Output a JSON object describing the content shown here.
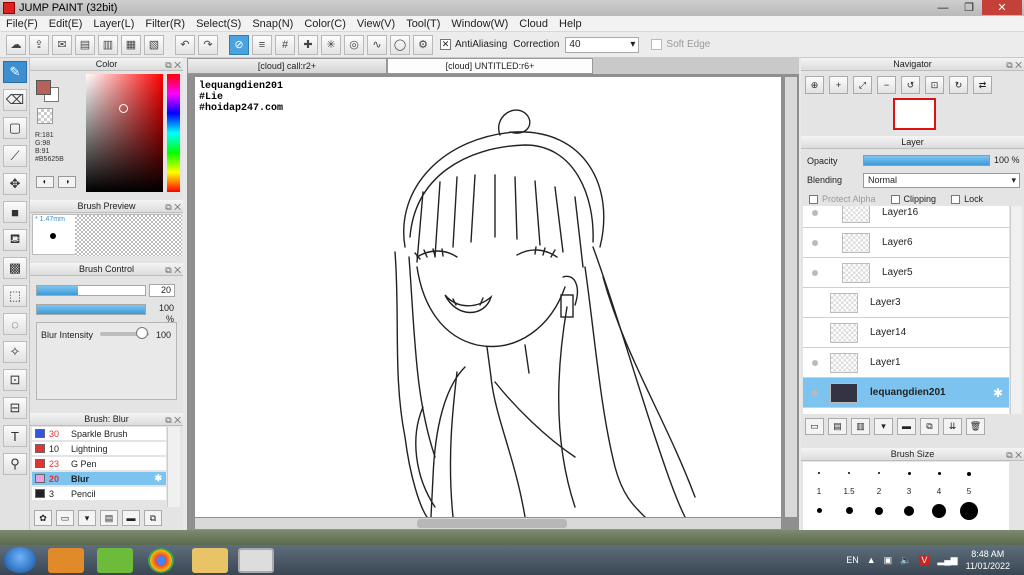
{
  "window": {
    "title": "JUMP PAINT (32bit)",
    "minimize": "—",
    "restore": "❐",
    "close": "✕"
  },
  "menu": [
    "File(F)",
    "Edit(E)",
    "Layer(L)",
    "Filter(R)",
    "Select(S)",
    "Snap(N)",
    "Color(C)",
    "View(V)",
    "Tool(T)",
    "Window(W)",
    "Cloud",
    "Help"
  ],
  "toolbar": {
    "antialiasing_label": "AntiAliasing",
    "correction_label": "Correction",
    "correction_value": "40",
    "soft_edge_label": "Soft Edge"
  },
  "color_panel": {
    "title": "Color",
    "r": "R:181",
    "g": "G:98",
    "b": "B:91",
    "hex": "#B5625B",
    "main_color": "#b5625b"
  },
  "brush_preview": {
    "title": "Brush Preview",
    "size": "* 1.47mm"
  },
  "brush_control": {
    "title": "Brush Control",
    "size_value": "20",
    "size_fraction": 0.38,
    "opacity_value": "100 %",
    "opacity_fraction": 1.0,
    "blur_label": "Blur Intensity",
    "blur_value": "100",
    "blur_fraction": 1.0
  },
  "brush_list": {
    "title": "Brush: Blur",
    "items": [
      {
        "size": "30",
        "name": "Sparkle Brush",
        "color": "#3355dd"
      },
      {
        "size": "10",
        "name": "Lightning",
        "color": "#e03333"
      },
      {
        "size": "23",
        "name": "G Pen",
        "color": "#e03333"
      },
      {
        "size": "20",
        "name": "Blur",
        "color": "#e7a0e0"
      },
      {
        "size": "3",
        "name": "Pencil",
        "color": "#222222"
      }
    ]
  },
  "canvas": {
    "tabs": [
      "[cloud] call:r2+",
      "[cloud] UNTITLED:r6+"
    ],
    "watermark": [
      "lequangdien201",
      "#Lie",
      "#hoidap247.com"
    ]
  },
  "navigator": {
    "title": "Navigator"
  },
  "layer_panel": {
    "title": "Layer",
    "opacity_label": "Opacity",
    "opacity_value": "100 %",
    "blending_label": "Blending",
    "blending_value": "Normal",
    "protect_alpha": "Protect Alpha",
    "clipping": "Clipping",
    "lock": "Lock",
    "layers": [
      "Layer16",
      "Layer6",
      "Layer5",
      "Layer3",
      "Layer14",
      "Layer1",
      "lequangdien201"
    ]
  },
  "brush_size": {
    "title": "Brush Size",
    "sizes": [
      "1",
      "1.5",
      "2",
      "3",
      "4",
      "5"
    ]
  },
  "taskbar": {
    "language": "EN",
    "time": "8:48 AM",
    "date": "11/01/2022"
  }
}
